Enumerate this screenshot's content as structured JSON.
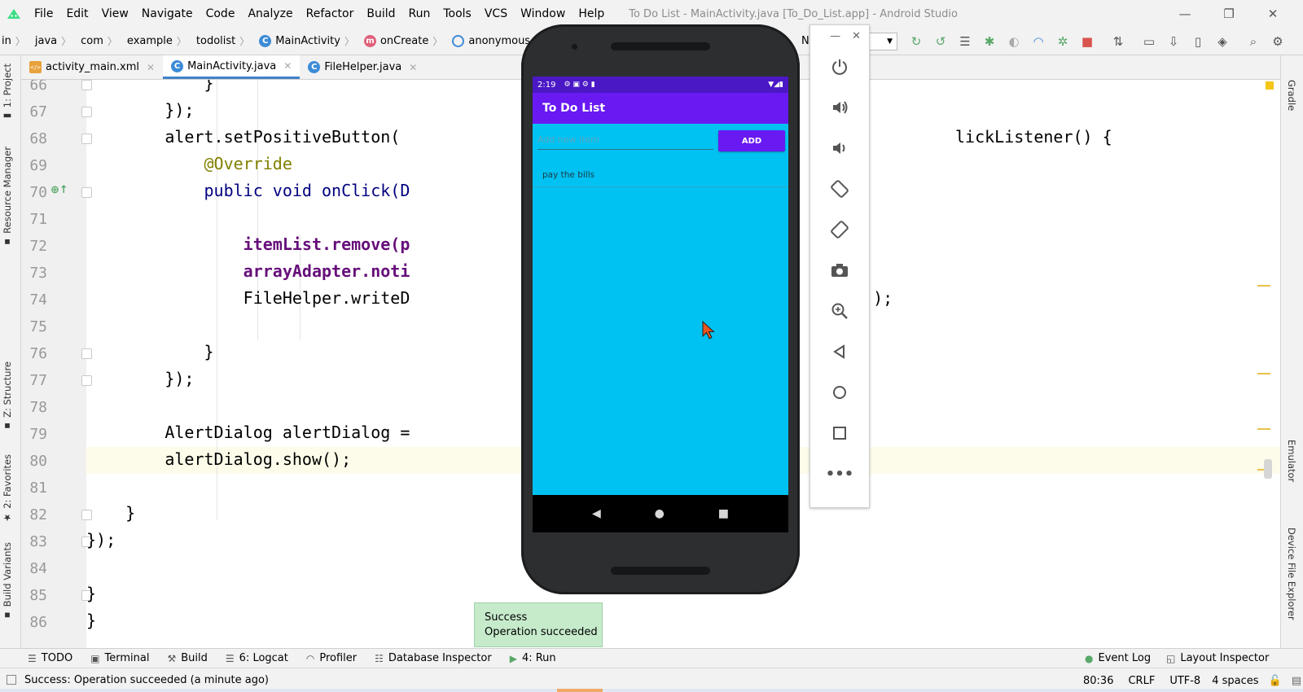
{
  "window": {
    "title": "To Do List - MainActivity.java [To_Do_List.app] - Android Studio",
    "controls": {
      "minimize": "—",
      "restore": "❐",
      "close": "✕"
    }
  },
  "menu": {
    "items": [
      "File",
      "Edit",
      "View",
      "Navigate",
      "Code",
      "Analyze",
      "Refactor",
      "Build",
      "Run",
      "Tools",
      "VCS",
      "Window",
      "Help"
    ]
  },
  "breadcrumb": {
    "items": [
      "in",
      "java",
      "com",
      "example",
      "todolist",
      "MainActivity",
      "onCreate",
      "anonymous OnItemClickL"
    ],
    "hidden_tail": "Ne",
    "device_selector": "0"
  },
  "tabs": [
    {
      "label": "activity_main.xml",
      "active": false
    },
    {
      "label": "MainActivity.java",
      "active": true
    },
    {
      "label": "FileHelper.java",
      "active": false
    }
  ],
  "left_strip": {
    "project": "1: Project",
    "resource_manager": "Resource Manager",
    "structure": "Z: Structure",
    "favorites": "2: Favorites",
    "build_variants": "Build Variants"
  },
  "right_strip": {
    "gradle": "Gradle",
    "emulator": "Emulator",
    "device_file_explorer": "Device File Explorer"
  },
  "editor": {
    "current_line": "80",
    "lines": [
      {
        "n": "66",
        "code": "            }"
      },
      {
        "n": "67",
        "code": "        });"
      },
      {
        "n": "68",
        "code": "        alert.setPositiveButton(",
        "tail": "lickListener() {"
      },
      {
        "n": "69",
        "code": "            @Override"
      },
      {
        "n": "70",
        "code": "            public void onClick(D",
        "tail": "{"
      },
      {
        "n": "71",
        "code": ""
      },
      {
        "n": "72",
        "code": "                itemList.remove(p"
      },
      {
        "n": "73",
        "code": "                arrayAdapter.noti"
      },
      {
        "n": "74",
        "code": "                FileHelper.writeD",
        "tail": "t());"
      },
      {
        "n": "75",
        "code": ""
      },
      {
        "n": "76",
        "code": "            }"
      },
      {
        "n": "77",
        "code": "        });"
      },
      {
        "n": "78",
        "code": ""
      },
      {
        "n": "79",
        "code": "        AlertDialog alertDialog ="
      },
      {
        "n": "80",
        "code": "        alertDialog.show();"
      },
      {
        "n": "81",
        "code": ""
      },
      {
        "n": "82",
        "code": "    }"
      },
      {
        "n": "83",
        "code": "});"
      },
      {
        "n": "84",
        "code": ""
      },
      {
        "n": "85",
        "code": "}"
      },
      {
        "n": "86",
        "code": "}"
      }
    ]
  },
  "phone": {
    "status_time": "2:19",
    "app_title": "To Do List",
    "input_placeholder": "Add new item",
    "add_button": "ADD",
    "items": [
      "pay the bills"
    ]
  },
  "emulator_panel": {
    "buttons": [
      "power",
      "volume-up",
      "volume-down",
      "rotate-left",
      "rotate-right",
      "screenshot",
      "zoom",
      "back",
      "home",
      "overview",
      "more"
    ]
  },
  "toast": {
    "title": "Success",
    "message": "Operation succeeded"
  },
  "tool_windows": {
    "todo": "TODO",
    "terminal": "Terminal",
    "build": "Build",
    "logcat": "6: Logcat",
    "profiler": "Profiler",
    "database_inspector": "Database Inspector",
    "run": "4: Run",
    "event_log": "Event Log",
    "layout_inspector": "Layout Inspector"
  },
  "status": {
    "message": "Success: Operation succeeded (a minute ago)",
    "position": "80:36",
    "line_separator": "CRLF",
    "encoding": "UTF-8",
    "indent": "4 spaces"
  },
  "colors": {
    "accent_tab": "#4083c9",
    "phone_app_bar": "#6919f2",
    "phone_status_bar": "#4a18c5",
    "phone_screen": "#00c2f2",
    "toast_bg": "#c6ebcb"
  }
}
